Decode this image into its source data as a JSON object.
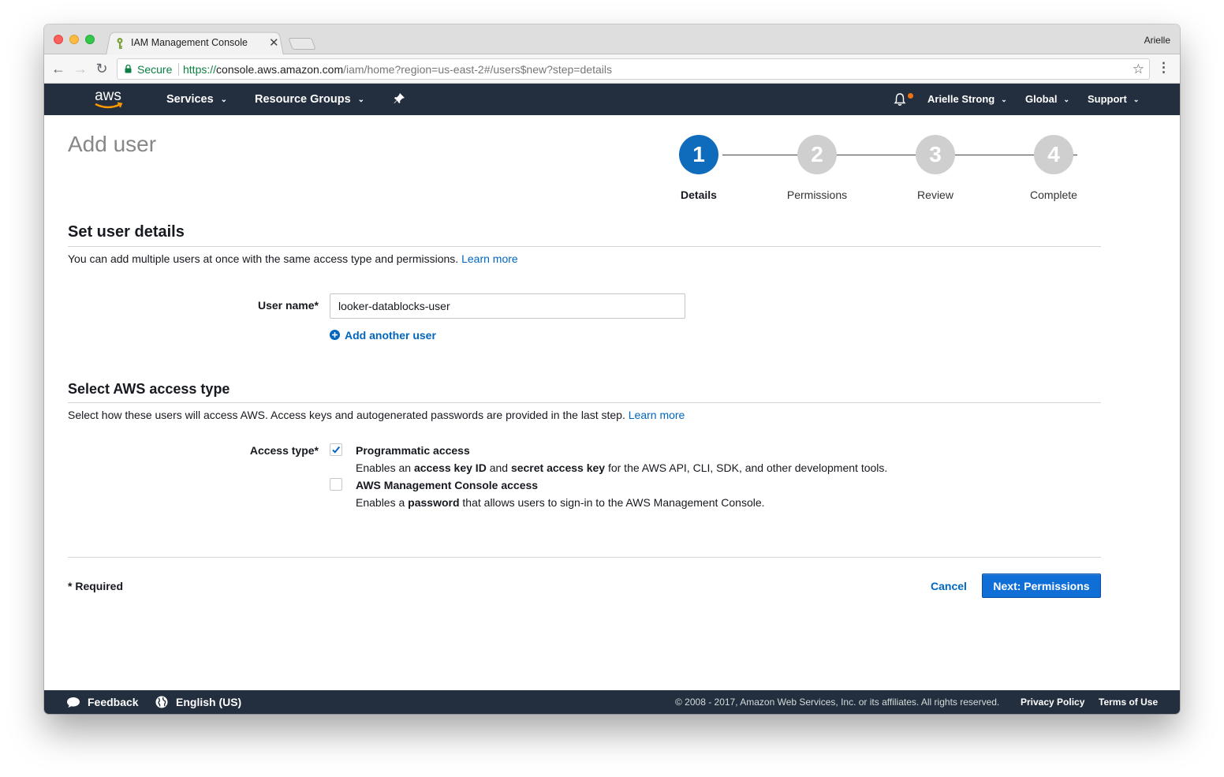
{
  "browser": {
    "tab_title": "IAM Management Console",
    "profile_name": "Arielle",
    "secure_label": "Secure",
    "url_scheme": "https://",
    "url_host": "console.aws.amazon.com",
    "url_path": "/iam/home?region=us-east-2#/users$new?step=details"
  },
  "awsnav": {
    "logo_text": "aws",
    "services": "Services",
    "resource_groups": "Resource Groups",
    "user": "Arielle Strong",
    "region": "Global",
    "support": "Support",
    "notification_color": "#ec7211"
  },
  "page": {
    "title": "Add user"
  },
  "stepper": {
    "steps": [
      {
        "number": "1",
        "label": "Details",
        "active": true
      },
      {
        "number": "2",
        "label": "Permissions",
        "active": false
      },
      {
        "number": "3",
        "label": "Review",
        "active": false
      },
      {
        "number": "4",
        "label": "Complete",
        "active": false
      }
    ]
  },
  "details": {
    "title": "Set user details",
    "description": "You can add multiple users at once with the same access type and permissions.",
    "learn_more": "Learn more",
    "user_name_label": "User name*",
    "user_name_value": "looker-datablocks-user",
    "add_another": "Add another user"
  },
  "access": {
    "title": "Select AWS access type",
    "description": "Select how these users will access AWS. Access keys and autogenerated passwords are provided in the last step.",
    "learn_more": "Learn more",
    "label": "Access type*",
    "options": [
      {
        "title": "Programmatic access",
        "checked": true,
        "desc_parts": [
          "Enables an ",
          "access key ID",
          " and ",
          "secret access key",
          " for the AWS API, CLI, SDK, and other development tools."
        ]
      },
      {
        "title": "AWS Management Console access",
        "checked": false,
        "desc_parts": [
          "Enables a ",
          "password",
          " that allows users to sign-in to the AWS Management Console."
        ]
      }
    ]
  },
  "actions": {
    "required": "* Required",
    "cancel": "Cancel",
    "next": "Next: Permissions"
  },
  "footer": {
    "feedback": "Feedback",
    "language": "English (US)",
    "copyright": "© 2008 - 2017, Amazon Web Services, Inc. or its affiliates. All rights reserved.",
    "privacy": "Privacy Policy",
    "terms": "Terms of Use"
  },
  "colors": {
    "nav_bg": "#232f3e",
    "primary": "#0f6fd6",
    "link": "#0066c0",
    "step_active": "#0f6cbd",
    "step_inactive": "#cfcfcf"
  }
}
